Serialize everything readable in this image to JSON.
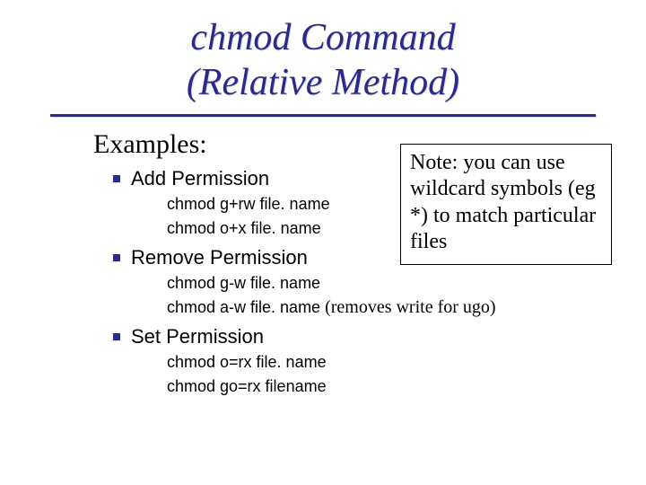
{
  "title": {
    "line1": "chmod Command",
    "line2": "(Relative Method)"
  },
  "examples_label": "Examples:",
  "sections": [
    {
      "heading": "Add Permission",
      "cmds": [
        {
          "text": "chmod g+rw file. name",
          "paren": ""
        },
        {
          "text": "chmod o+x file. name",
          "paren": ""
        }
      ]
    },
    {
      "heading": "Remove Permission",
      "cmds": [
        {
          "text": "chmod g-w file. name",
          "paren": ""
        },
        {
          "text": "chmod a-w file. name",
          "paren": "  (removes write for ugo)"
        }
      ]
    },
    {
      "heading": "Set Permission",
      "cmds": [
        {
          "text": "chmod o=rx file. name",
          "paren": ""
        },
        {
          "text": "chmod go=rx filename",
          "paren": ""
        }
      ]
    }
  ],
  "note": "Note: you can use wildcard symbols (eg *) to match particular files"
}
